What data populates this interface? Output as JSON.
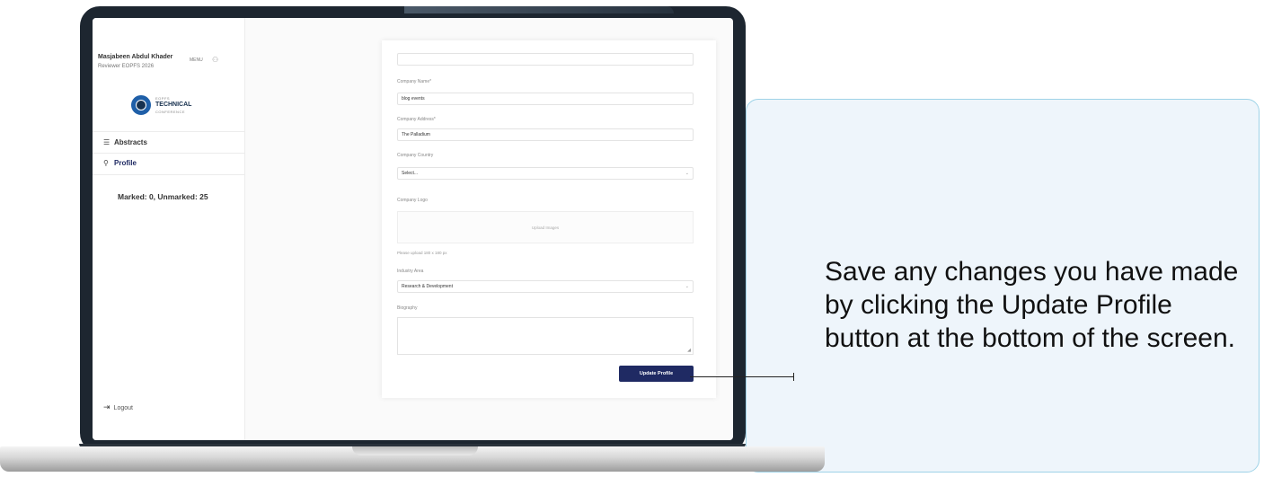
{
  "callout": {
    "text": "Save any changes you have made by clicking the Update Profile button at the bottom of the screen."
  },
  "user": {
    "name": "Masjabeen Abdul Khader",
    "role": "Reviewer  EOPFS 2026",
    "control_label": "MENU",
    "control_icon": "user-icon"
  },
  "logo": {
    "line1": "EOPFS",
    "line2": "TECHNICAL",
    "line3": "CONFERENCE"
  },
  "nav": {
    "items": [
      {
        "label": "Abstracts",
        "icon": "list-icon",
        "glyph": "☰"
      },
      {
        "label": "Profile",
        "icon": "person-icon",
        "glyph": "⚲"
      }
    ],
    "counter": "Marked: 0, Unmarked: 25",
    "logout_label": "Logout",
    "logout_icon": "logout-icon",
    "logout_glyph": "⇥"
  },
  "form": {
    "company_name_label": "Company Name*",
    "company_name_value": "blog events",
    "company_address_label": "Company Address*",
    "company_address_value": "The Palladium",
    "company_country_label": "Company Country",
    "company_country_value": "Select...",
    "company_logo_label": "Company Logo",
    "upload_label": "Upload Images",
    "logo_hint": "Please upload 180 x 180 px",
    "industry_label": "Industry Area",
    "industry_value": "Research & Development",
    "biography_label": "Biography",
    "biography_value": "",
    "update_button_label": "Update Profile"
  },
  "colors": {
    "accent": "#1f2a63",
    "callout_bg": "#eef5fb",
    "callout_border": "#9fd3e8",
    "bezel": "#1d2630"
  }
}
